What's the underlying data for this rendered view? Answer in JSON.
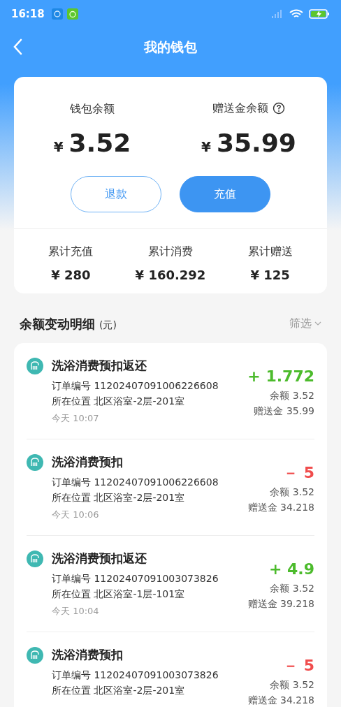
{
  "status_bar": {
    "time": "16:18"
  },
  "header": {
    "title": "我的钱包"
  },
  "balance": {
    "wallet_label": "钱包余额",
    "wallet_currency": "¥",
    "wallet_amount": "3.52",
    "gift_label": "赠送金余额",
    "gift_currency": "¥",
    "gift_amount": "35.99"
  },
  "buttons": [
    {
      "label": "退款",
      "kind": "outline"
    },
    {
      "label": "充值",
      "kind": "primary"
    }
  ],
  "stats": [
    {
      "label": "累计充值",
      "value": "¥ 280"
    },
    {
      "label": "累计消费",
      "value": "¥ 160.292"
    },
    {
      "label": "累计赠送",
      "value": "¥ 125"
    }
  ],
  "section": {
    "title": "余额变动明细",
    "unit": "(元)",
    "filter": "筛选"
  },
  "transactions": [
    {
      "title": "洗浴消费预扣返还",
      "order": "订单编号 11202407091006226608",
      "location": "所在位置 北区浴室-2层-201室",
      "time": "今天 10:07",
      "kind": "income",
      "amount": "+ 1.772",
      "balance": "余额 3.52",
      "gift": "赠送金 35.99"
    },
    {
      "title": "洗浴消费预扣",
      "order": "订单编号 11202407091006226608",
      "location": "所在位置 北区浴室-2层-201室",
      "time": "今天 10:06",
      "kind": "expense",
      "amount": "－ 5",
      "balance": "余额 3.52",
      "gift": "赠送金 34.218"
    },
    {
      "title": "洗浴消费预扣返还",
      "order": "订单编号 11202407091003073826",
      "location": "所在位置 北区浴室-1层-101室",
      "time": "今天 10:04",
      "kind": "income",
      "amount": "+ 4.9",
      "balance": "余额 3.52",
      "gift": "赠送金 39.218"
    },
    {
      "title": "洗浴消费预扣",
      "order": "订单编号 11202407091003073826",
      "location": "所在位置 北区浴室-2层-201室",
      "kind": "expense",
      "amount": "－ 5",
      "balance": "余额 3.52",
      "gift": "赠送金 34.218"
    }
  ]
}
